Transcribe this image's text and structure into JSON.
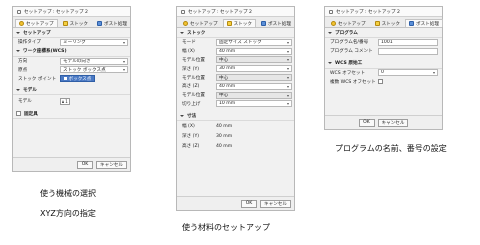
{
  "dialogs": [
    {
      "title": "セットアップ : セットアップ 2",
      "tabs": [
        "セットアップ",
        "ストック",
        "ポスト処理"
      ],
      "setup_section": "セットアップ",
      "operation_type_label": "操作タイプ",
      "operation_type_value": "ミーリング",
      "wcs_section": "ワーク座標系(WCS)",
      "direction_label": "方向",
      "direction_value": "モデルの向き",
      "origin_label": "原点",
      "origin_value": "ストック ボックス点",
      "stock_point_label": "ストック ポイント",
      "stock_point_value": "ボックス点",
      "model_section": "モデル",
      "model_label": "モデル",
      "model_count": "1",
      "fixture_label": "固定具",
      "ok": "OK",
      "cancel": "キャンセル"
    },
    {
      "title": "セットアップ : セットアップ 2",
      "tabs": [
        "セットアップ",
        "ストック",
        "ポスト処理"
      ],
      "stock_section": "ストック",
      "mode_label": "モード",
      "mode_value": "固定サイズ ストック",
      "width_label": "幅 (X)",
      "width_value": "40 mm",
      "model_pos_x_label": "モデル位置",
      "model_pos_x_value": "中心",
      "depth_label": "深さ (Y)",
      "depth_value": "30 mm",
      "model_pos_y_label": "モデル位置",
      "model_pos_y_value": "中心",
      "height_label": "高さ (Z)",
      "height_value": "40 mm",
      "model_pos_z_label": "モデル位置",
      "model_pos_z_value": "中心",
      "cut_up_label": "切り上げ",
      "cut_up_value": "10 mm",
      "dim_section": "寸法",
      "dim_width_label": "幅 (X)",
      "dim_width_value": "40 mm",
      "dim_depth_label": "深さ (Y)",
      "dim_depth_value": "30 mm",
      "dim_height_label": "高さ (Z)",
      "dim_height_value": "40 mm",
      "ok": "OK",
      "cancel": "キャンセル"
    },
    {
      "title": "セットアップ : セットアップ 2",
      "tabs": [
        "セットアップ",
        "ストック",
        "ポスト処理"
      ],
      "program_section": "プログラム",
      "program_name_label": "プログラム名/番号",
      "program_name_value": "1001",
      "program_comment_label": "プログラム コメント",
      "program_comment_value": "",
      "wcs_section": "WCS 原始工",
      "wcs_offset_label": "WCS オフセット",
      "wcs_offset_value": "0",
      "multi_wcs_label": "複数 WCS オフセット",
      "ok": "OK",
      "cancel": "キャンセル"
    }
  ],
  "captions": {
    "left_line1": "使う機械の選択",
    "left_line2": "XYZ方向の指定",
    "middle": "使う材料のセットアップ",
    "right": "プログラムの名前、番号の設定"
  }
}
